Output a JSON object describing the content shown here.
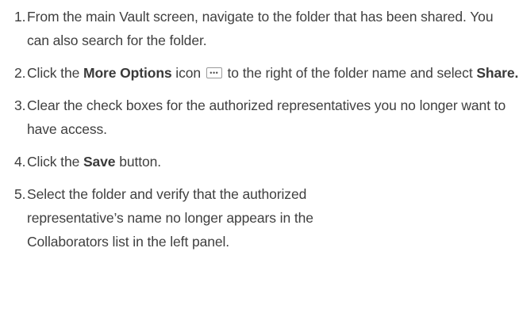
{
  "steps": [
    {
      "number": "1.",
      "text": "From the main Vault screen, navigate to the folder that has been shared. You can also search for the folder."
    },
    {
      "number": "2.",
      "t1": "Click the ",
      "b1": "More Options",
      "t2": " icon",
      "icon": "more-options-icon",
      "icon_glyph": "•••",
      "t3": " to the right of the folder name and select ",
      "b2": "Share."
    },
    {
      "number": "3.",
      "text": "Clear the check boxes for the authorized representatives you no longer want to have access."
    },
    {
      "number": "4.",
      "t1": "Click the ",
      "b1": "Save",
      "t2": " button."
    },
    {
      "number": "5.",
      "line1": "Select the folder and verify that the authorized",
      "line2": "representative’s name no longer appears in the",
      "line3": "Collaborators list in the left panel."
    }
  ]
}
